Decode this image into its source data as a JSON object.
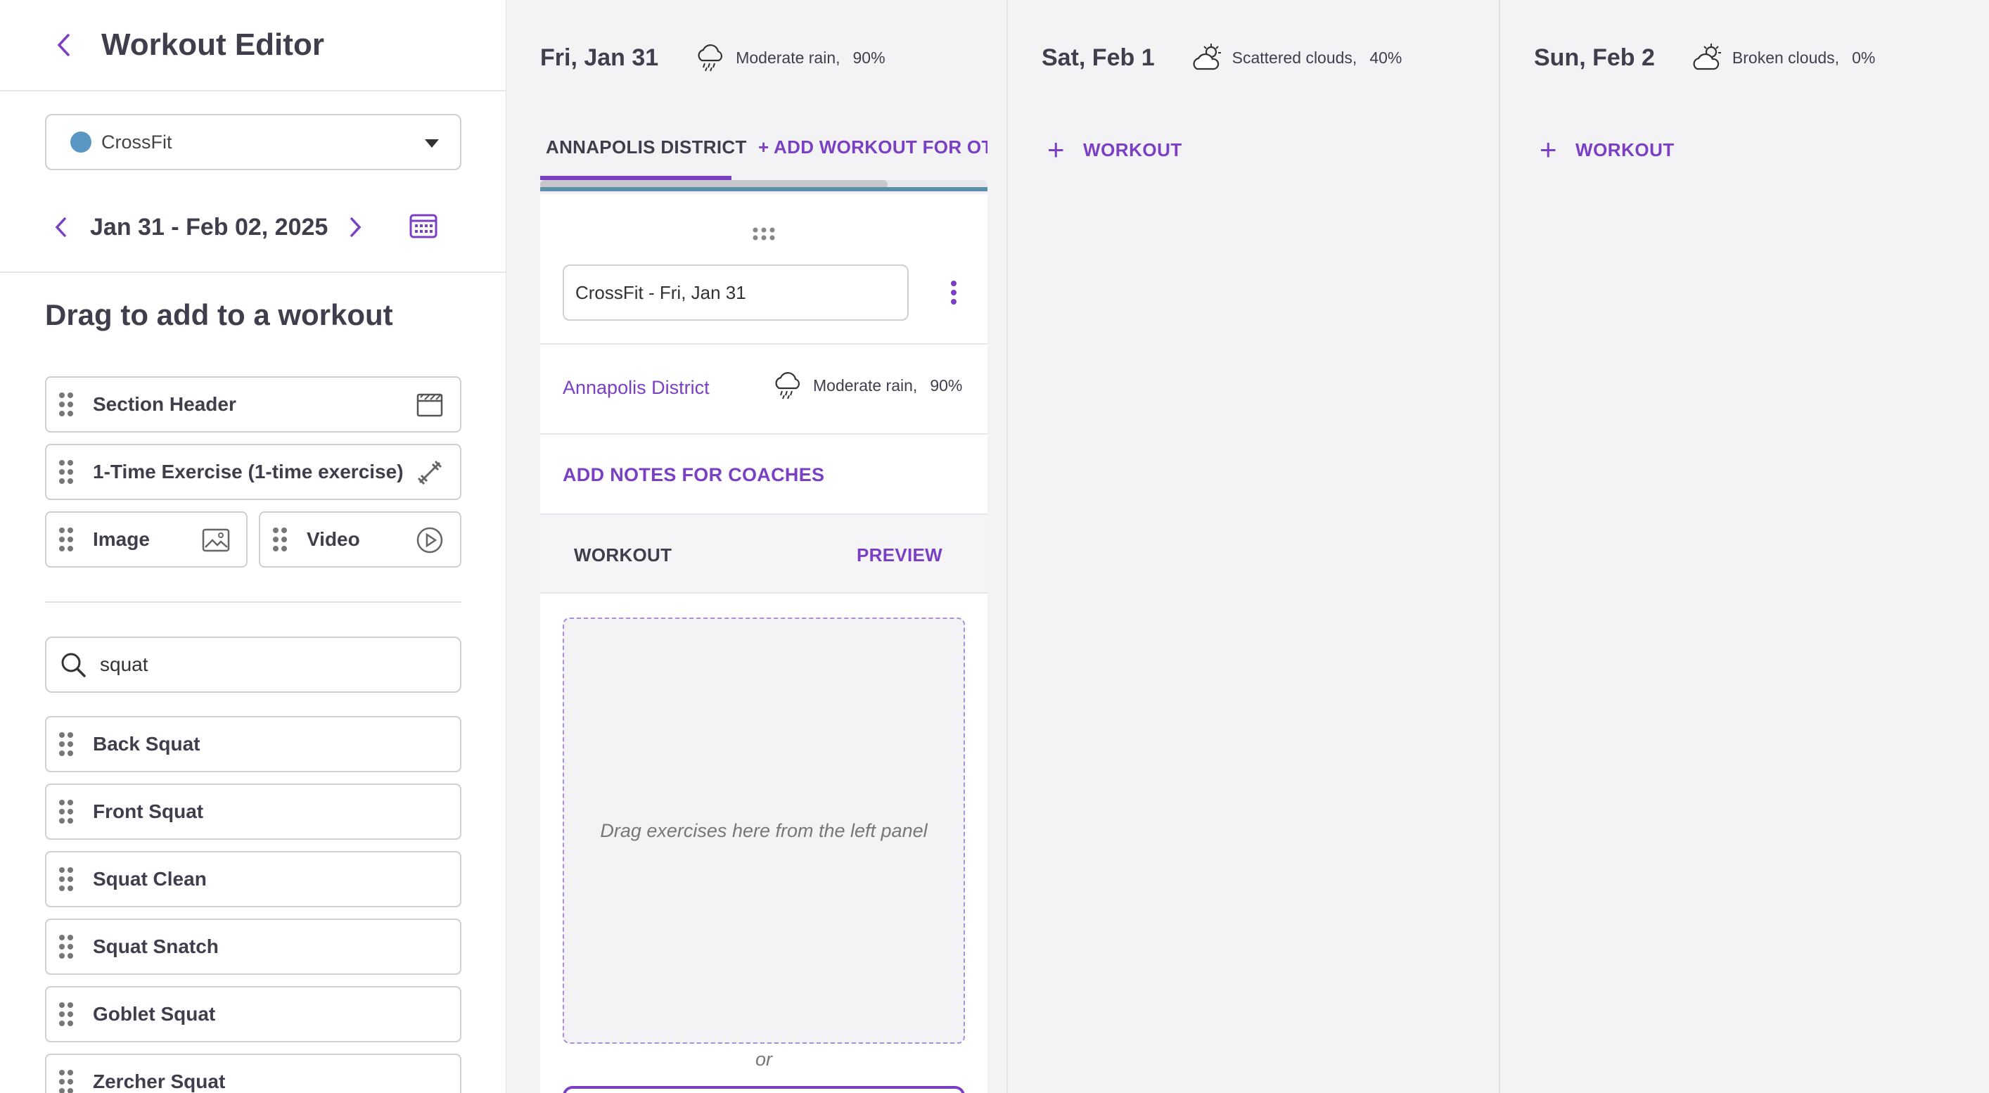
{
  "sidebar": {
    "title": "Workout Editor",
    "program": {
      "name": "CrossFit",
      "color": "#5a96c4"
    },
    "date_range": "Jan 31 - Feb 02, 2025",
    "drag_title": "Drag to add to a workout",
    "blocks": {
      "section_header": "Section Header",
      "one_time": "1-Time Exercise (1-time exercise)",
      "image": "Image",
      "video": "Video"
    },
    "search": {
      "value": "squat",
      "placeholder": ""
    },
    "exercises": [
      "Back Squat",
      "Front Squat",
      "Squat Clean",
      "Squat Snatch",
      "Goblet Squat",
      "Zercher Squat"
    ]
  },
  "days": [
    {
      "title": "Fri, Jan 31",
      "weather": {
        "icon": "rain-cloud-icon",
        "text": "Moderate rain,",
        "pct": "90%"
      },
      "tabs": {
        "active": "ANNAPOLIS DISTRICT",
        "other": "+ ADD WORKOUT FOR OTHER"
      },
      "card": {
        "name": "CrossFit - Fri, Jan 31",
        "location": "Annapolis District",
        "loc_weather": {
          "text": "Moderate rain,",
          "pct": "90%"
        },
        "notes_link": "ADD NOTES FOR COACHES",
        "workout_label": "WORKOUT",
        "preview_label": "PREVIEW",
        "drop_text": "Drag exercises here from the left panel",
        "or_text": "or"
      }
    },
    {
      "title": "Sat, Feb 1",
      "weather": {
        "icon": "sun-cloud-icon",
        "text": "Scattered clouds,",
        "pct": "40%"
      },
      "add_label": "WORKOUT"
    },
    {
      "title": "Sun, Feb 2",
      "weather": {
        "icon": "sun-cloud-icon",
        "text": "Broken clouds,",
        "pct": "0%"
      },
      "add_label": "WORKOUT"
    }
  ],
  "colors": {
    "accent": "#7b3fc4",
    "program_dot": "#5a96c4",
    "scroll_line": "#5b8faa"
  }
}
